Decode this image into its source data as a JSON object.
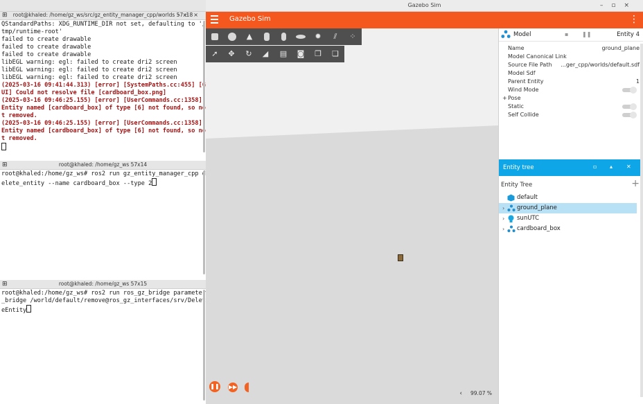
{
  "terminal1": {
    "title": "root@khaled: /home/gz_ws/src/gz_entity_manager_cpp/worlds 57x18",
    "lines": [
      {
        "text": "QStandardPaths: XDG_RUNTIME_DIR not set, defaulting to '/tmp/runtime-root'",
        "error": false
      },
      {
        "text": "failed to create drawable",
        "error": false
      },
      {
        "text": "failed to create drawable",
        "error": false
      },
      {
        "text": "failed to create drawable",
        "error": false
      },
      {
        "text": "libEGL warning: egl: failed to create dri2 screen",
        "error": false
      },
      {
        "text": "libEGL warning: egl: failed to create dri2 screen",
        "error": false
      },
      {
        "text": "libEGL warning: egl: failed to create dri2 screen",
        "error": false
      },
      {
        "text": "(2025-03-16 09:41:44.313) [error] [SystemPaths.cc:455] [GUI] Could not resolve file [cardboard_box.png]",
        "error": true
      },
      {
        "text": "(2025-03-16 09:46:25.155) [error] [UserCommands.cc:1358] Entity named [cardboard_box] of type [6] not found, so not removed.",
        "error": true
      },
      {
        "text": "(2025-03-16 09:46:25.155) [error] [UserCommands.cc:1358] Entity named [cardboard_box] of type [6] not found, so not removed.",
        "error": true
      }
    ]
  },
  "terminal2": {
    "title": "root@khaled: /home/gz_ws 57x14",
    "command": "root@khaled:/home/gz_ws# ros2 run gz_entity_manager_cpp delete_entity --name cardboard_box --type 2"
  },
  "terminal3": {
    "title": "root@khaled: /home/gz_ws 57x15",
    "command": "root@khaled:/home/gz_ws# ros2 run ros_gz_bridge parameter_bridge /world/default/remove@ros_gz_interfaces/srv/DeleteEntity"
  },
  "gazebo": {
    "window_title": "Gazebo Sim",
    "app_title": "Gazebo Sim",
    "accent_color": "#f5581e",
    "zoom": "99.07 %",
    "component": {
      "title": "Model",
      "entity": "Entity 4",
      "props": [
        {
          "key": "Name",
          "value": "ground_plane"
        },
        {
          "key": "Model Canonical Link",
          "value": ""
        },
        {
          "key": "Source File Path",
          "value": "...ger_cpp/worlds/default.sdf"
        },
        {
          "key": "Model Sdf",
          "value": ""
        },
        {
          "key": "Parent Entity",
          "value": "1"
        }
      ],
      "wind_mode": "Wind Mode",
      "pose": "Pose",
      "static": "Static",
      "self_collide": "Self Collide"
    },
    "entity_tree": {
      "header": "Entity tree",
      "sub_header": "Entity Tree",
      "items": [
        {
          "label": "default",
          "selected": false,
          "expandable": false
        },
        {
          "label": "ground_plane",
          "selected": true,
          "expandable": true
        },
        {
          "label": "sunUTC",
          "selected": false,
          "expandable": true
        },
        {
          "label": "cardboard_box",
          "selected": false,
          "expandable": true
        }
      ]
    }
  }
}
